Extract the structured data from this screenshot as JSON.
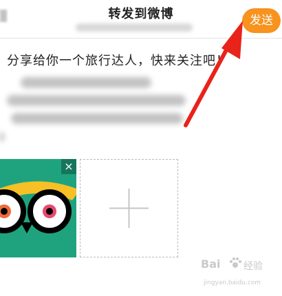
{
  "header": {
    "title": "转发到微博",
    "send_label": "发送"
  },
  "post": {
    "text": "分享给你一个旅行达人，快来关注吧！"
  },
  "attachments": {
    "close_symbol": "×",
    "add_icon": "plus-icon"
  },
  "watermark": {
    "brand": "Bai",
    "brand_cn": "经验",
    "url": "jingyan.baidu.com"
  },
  "colors": {
    "send": "#f7931e",
    "thumb_bg": "#1fa37f",
    "arrow": "#e8231a"
  }
}
